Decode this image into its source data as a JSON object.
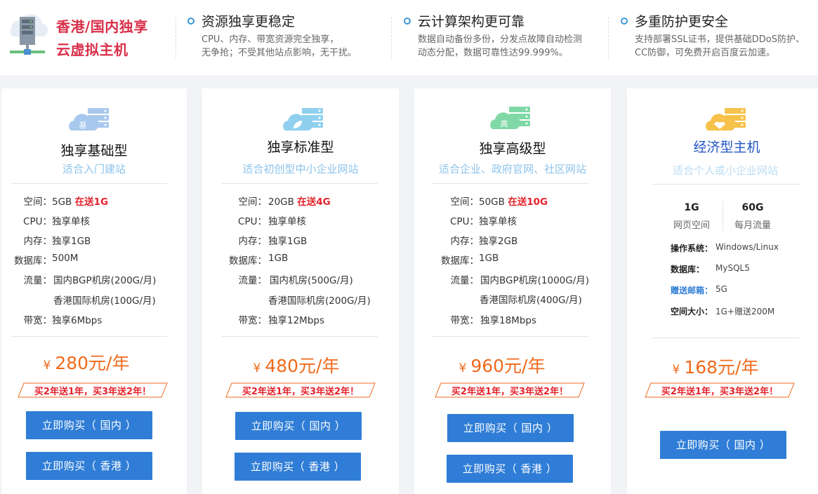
{
  "banner": {
    "title_line1": "香港/国内独享",
    "title_line2": "云虚拟主机",
    "features": [
      {
        "title": "资源独享更稳定",
        "line1": "CPU、内存、带宽资源完全独享，",
        "line2": "无争抢；不受其他站点影响，无干扰。"
      },
      {
        "title": "云计算架构更可靠",
        "line1": "数据自动备份多份，分发点故障自动检测",
        "line2": "动态分配，数据可靠性达99.999%。"
      },
      {
        "title": "多重防护更安全",
        "line1": "支持部署SSL证书，提供基础DDoS防护、",
        "line2": "CC防御，可免费开启百度云加速。"
      }
    ]
  },
  "plans": [
    {
      "icon_char": "基",
      "icon_color": "#a8c8ee",
      "name": "独享基础型",
      "subtitle": "适合入门建站",
      "specs": [
        {
          "label": "空间：",
          "value": "5GB",
          "gift": "在送1G"
        },
        {
          "label": "CPU：",
          "value": "独享单核"
        },
        {
          "label": "内存：",
          "value": "独享1GB"
        },
        {
          "label": "数据库：",
          "value": "500M"
        },
        {
          "label": "流量：",
          "value": "国内BGP机房(200G/月)"
        },
        {
          "label": "",
          "value": "香港国际机房(100G/月)"
        },
        {
          "label": "带宽：",
          "value": "独享6Mbps"
        }
      ],
      "currency": "¥",
      "price": "280元/年",
      "promo": "买2年送1年，买3年送2年！",
      "buy_cn": "立即购买（ 国内 ）",
      "buy_hk": "立即购买（ 香港 ）"
    },
    {
      "icon_char": "",
      "icon_color": "#8fd0ee",
      "name": "独享标准型",
      "subtitle": "适合初创型中小企业网站",
      "specs": [
        {
          "label": "空间：",
          "value": "20GB",
          "gift": "在送4G"
        },
        {
          "label": "CPU：",
          "value": "独享单核"
        },
        {
          "label": "内存：",
          "value": "独享1GB"
        },
        {
          "label": "数据库：",
          "value": "1GB"
        },
        {
          "label": "流量：",
          "value": "国内机房(500G/月)"
        },
        {
          "label": "",
          "value": "香港国际机房(200G/月)"
        },
        {
          "label": "带宽：",
          "value": "独享12Mbps"
        }
      ],
      "currency": "¥",
      "price": "480元/年",
      "promo": "买2年送1年，买3年送2年！",
      "buy_cn": "立即购买（ 国内 ）",
      "buy_hk": "立即购买（ 香港 ）"
    },
    {
      "icon_char": "高",
      "icon_color": "#7fd8a6",
      "name": "独享高级型",
      "subtitle": "适合企业、政府官网、社区网站",
      "specs": [
        {
          "label": "空间：",
          "value": "50GB",
          "gift": "在送10G"
        },
        {
          "label": "CPU：",
          "value": "独享单核"
        },
        {
          "label": "内存：",
          "value": "独享2GB"
        },
        {
          "label": "数据库：",
          "value": "1GB"
        },
        {
          "label": "流量：",
          "value": "国内BGP机房(1000G/月)"
        },
        {
          "label": "",
          "value": "香港国际机房(400G/月)"
        },
        {
          "label": "带宽：",
          "value": "独享18Mbps"
        }
      ],
      "currency": "¥",
      "price": "960元/年",
      "promo": "买2年送1年，买3年送2年！",
      "buy_cn": "立即购买（ 国内 ）",
      "buy_hk": "立即购买（ 香港 ）"
    }
  ],
  "economy": {
    "icon_color": "#f7c24a",
    "name": "经济型主机",
    "subtitle": "适合个人或小企业网站",
    "metrics": [
      {
        "value": "1G",
        "label": "网页空间"
      },
      {
        "value": "60G",
        "label": "每月流量"
      }
    ],
    "rows": [
      {
        "label": "操作系统：",
        "value": "Windows/Linux",
        "highlight": false
      },
      {
        "label": "数据库：",
        "value": "MySQL5",
        "highlight": false
      },
      {
        "label": "赠送邮箱：",
        "value": "5G",
        "highlight": true
      },
      {
        "label": "空间大小：",
        "value": "1G+赠送200M",
        "highlight": false
      }
    ],
    "currency": "¥",
    "price": "168元/年",
    "promo": "买2年送1年，买3年送2年！",
    "buy_cn": "立即购买（ 国内 ）"
  }
}
